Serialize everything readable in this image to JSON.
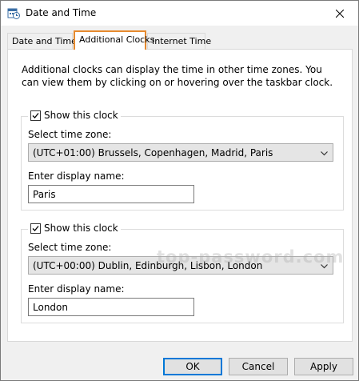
{
  "window": {
    "title": "Date and Time"
  },
  "tabs": [
    {
      "label": "Date and Time",
      "active": false
    },
    {
      "label": "Additional Clocks",
      "active": true
    },
    {
      "label": "Internet Time",
      "active": false
    }
  ],
  "panel": {
    "description": "Additional clocks can display the time in other time zones. You can view them by clicking on or hovering over the taskbar clock."
  },
  "clocks": [
    {
      "show_label": "Show this clock",
      "checked": true,
      "timezone_label": "Select time zone:",
      "timezone_value": "(UTC+01:00) Brussels, Copenhagen, Madrid, Paris",
      "name_label": "Enter display name:",
      "name_value": "Paris"
    },
    {
      "show_label": "Show this clock",
      "checked": true,
      "timezone_label": "Select time zone:",
      "timezone_value": "(UTC+00:00) Dublin, Edinburgh, Lisbon, London",
      "name_label": "Enter display name:",
      "name_value": "London"
    }
  ],
  "buttons": {
    "ok": "OK",
    "cancel": "Cancel",
    "apply": "Apply"
  },
  "watermark": "top-password.com",
  "colors": {
    "active_tab_border": "#e68a2e",
    "default_button_border": "#0078d7"
  }
}
